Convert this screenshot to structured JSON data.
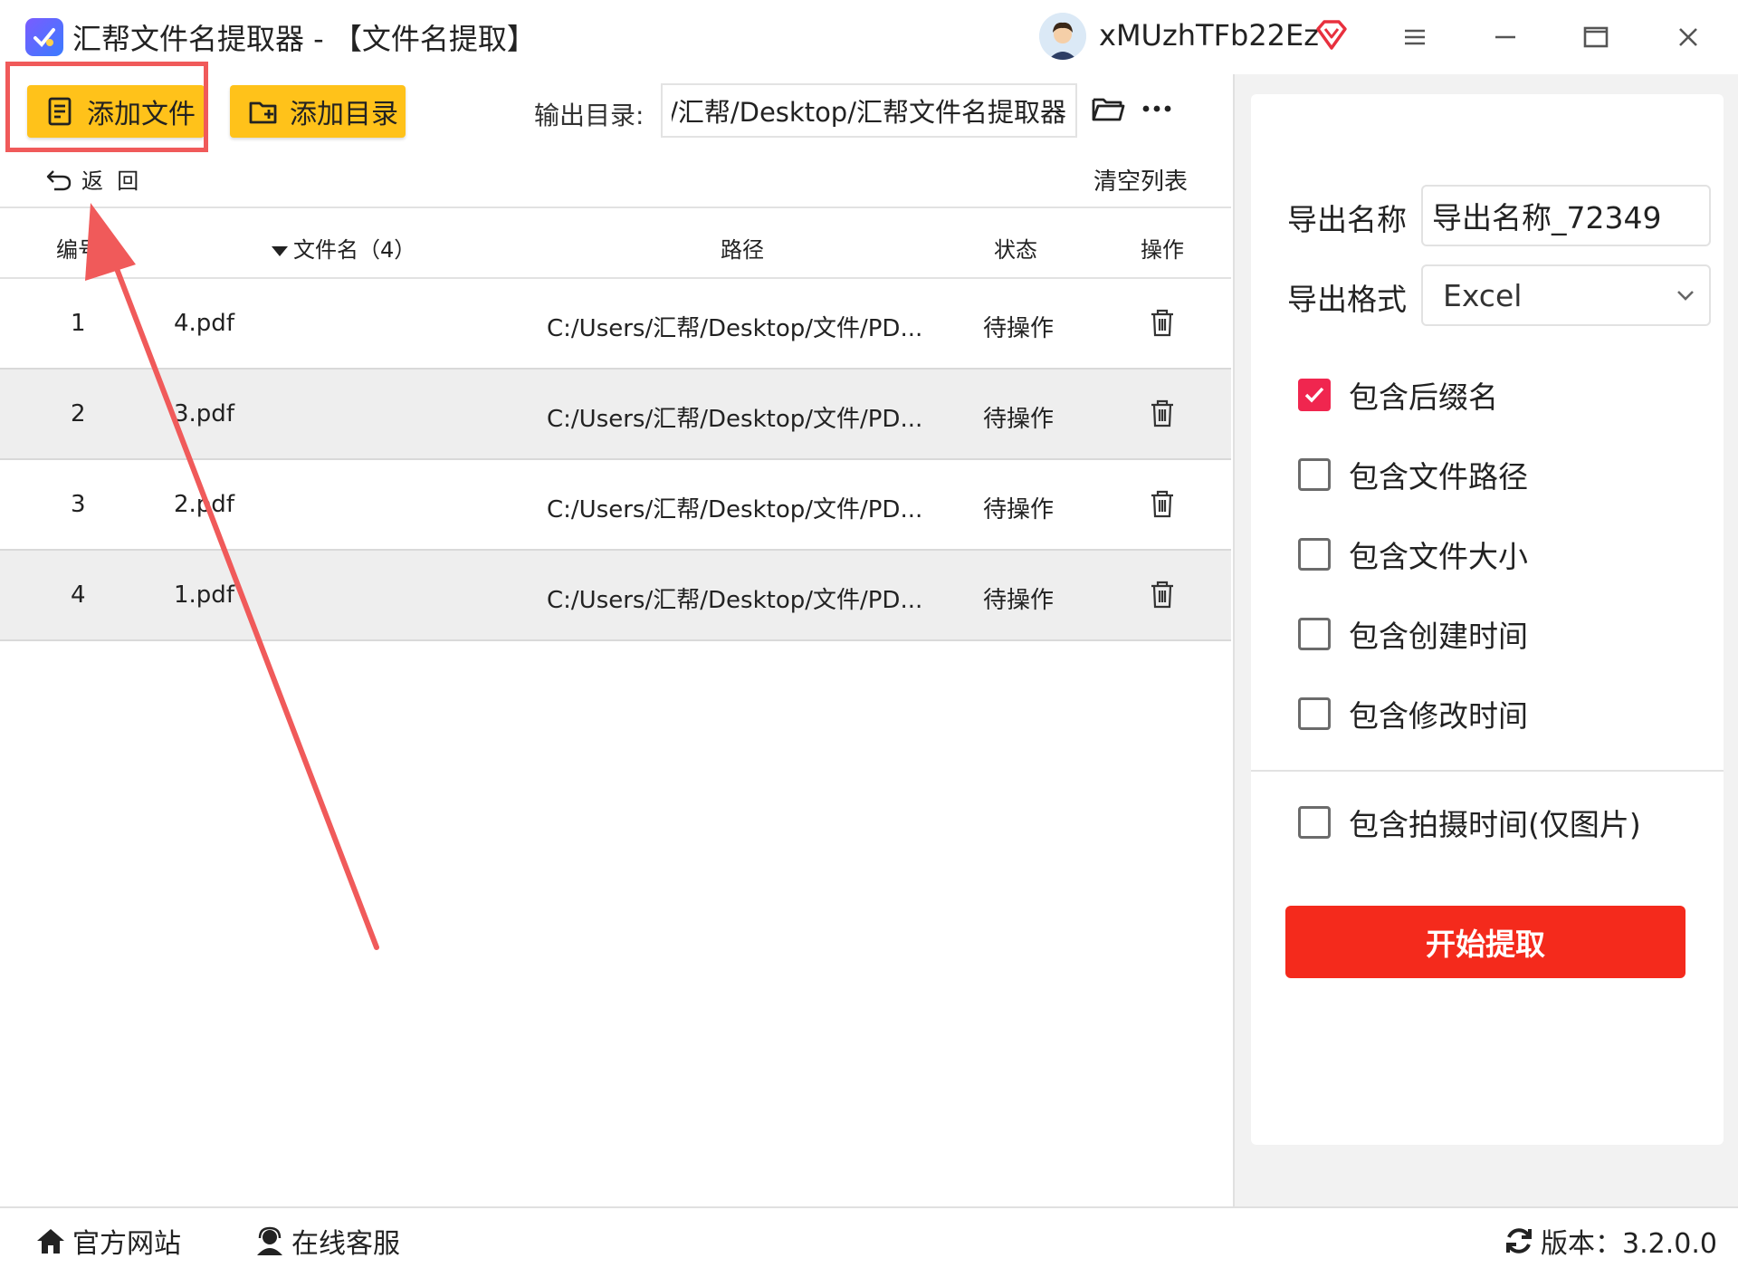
{
  "window": {
    "title": "汇帮文件名提取器 - 【文件名提取】",
    "username": "xMUzhTFb22Ez"
  },
  "toolbar": {
    "add_file_label": "添加文件",
    "add_dir_label": "添加目录",
    "output_label": "输出目录:",
    "output_value": "C:/Users/汇帮/Desktop/汇帮文件名提取器",
    "back_label": "返  回",
    "clear_label": "清空列表"
  },
  "table": {
    "headers": {
      "num": "编号",
      "name": "文件名（4）",
      "path": "路径",
      "status": "状态",
      "op": "操作"
    },
    "rows": [
      {
        "num": "1",
        "name": "4.pdf",
        "path": "C:/Users/汇帮/Desktop/文件/PD...",
        "status": "待操作"
      },
      {
        "num": "2",
        "name": "3.pdf",
        "path": "C:/Users/汇帮/Desktop/文件/PD...",
        "status": "待操作"
      },
      {
        "num": "3",
        "name": "2.pdf",
        "path": "C:/Users/汇帮/Desktop/文件/PD...",
        "status": "待操作"
      },
      {
        "num": "4",
        "name": "1.pdf",
        "path": "C:/Users/汇帮/Desktop/文件/PD...",
        "status": "待操作"
      }
    ]
  },
  "settings": {
    "export_name_label": "导出名称",
    "export_name_value": "导出名称_72349",
    "export_format_label": "导出格式",
    "export_format_value": "Excel",
    "options": [
      {
        "label": "包含后缀名",
        "checked": true
      },
      {
        "label": "包含文件路径",
        "checked": false
      },
      {
        "label": "包含文件大小",
        "checked": false
      },
      {
        "label": "包含创建时间",
        "checked": false
      },
      {
        "label": "包含修改时间",
        "checked": false
      },
      {
        "label": "包含拍摄时间(仅图片)",
        "checked": false
      }
    ],
    "start_label": "开始提取"
  },
  "statusbar": {
    "website_label": "官方网站",
    "support_label": "在线客服",
    "version_label": "版本：3.2.0.0"
  },
  "colors": {
    "accent_yellow": "#ffc21a",
    "start_red": "#f42a1c",
    "check_pink": "#f0264f",
    "annotation_red": "#f05a5a"
  }
}
